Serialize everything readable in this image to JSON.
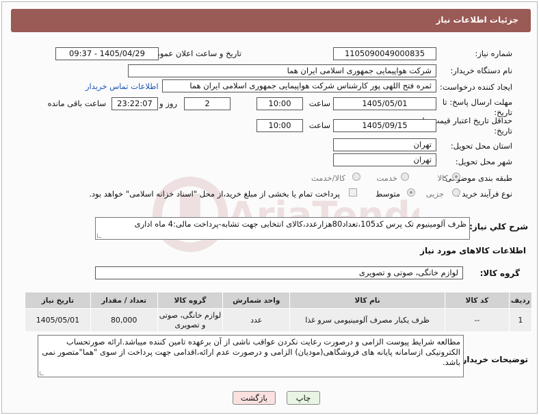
{
  "header": {
    "title": "جزئیات اطلاعات نیاز"
  },
  "fields": {
    "need_number_label": "شماره نیاز:",
    "need_number": "1105090049000835",
    "announce_label": "تاریخ و ساعت اعلان عمومی:",
    "announce_value": "1405/04/29 - 09:37",
    "buyer_org_label": "نام دستگاه خریدار:",
    "buyer_org": "شرکت هواپیمایی جمهوری اسلامی ایران هما",
    "requester_label": "ایجاد کننده درخواست:",
    "requester": "ثمره فتح اللهی پور کارشناس شرکت هواپیمایی جمهوری اسلامی ایران هما",
    "contact_link": "اطلاعات تماس خریدار",
    "reply_deadline_label": "مهلت ارسال پاسخ: تا تاریخ:",
    "reply_date": "1405/05/01",
    "time_label": "ساعت",
    "reply_time": "10:00",
    "days": "2",
    "days_label": "روز و",
    "remaining_time": "23:22:07",
    "remaining_label": "ساعت باقی مانده",
    "price_validity_label": "حداقل تاریخ اعتبار قیمت: تا تاریخ:",
    "price_date": "1405/09/15",
    "price_time": "10:00",
    "province_label": "استان محل تحویل:",
    "province": "تهران",
    "city_label": "شهر محل تحویل:",
    "city": "تهران",
    "category_label": "طبقه بندی موضوعی:",
    "category_options": [
      "کالا",
      "خدمت",
      "کالا/خدمت"
    ],
    "process_label": "نوع فرآیند خرید :",
    "process_options": [
      "جزیی",
      "متوسط"
    ],
    "payment_note": "پرداخت تمام یا بخشی از مبلغ خرید،از محل \"اسناد خزانه اسلامی\" خواهد بود."
  },
  "description": {
    "label": "شرح کلي نیاز:",
    "text": "ظرف آلومینیوم تک پرس کد105،تعداد80هزارعدد،کالای انتخابی جهت تشابه-پرداخت مالی:4 ماه اداری"
  },
  "goods_info": {
    "title": "اطلاعات کالاهای مورد نیاز",
    "group_label": "گروه کالا:",
    "group_value": "لوازم خانگی، صوتی و تصویری"
  },
  "table": {
    "headers": [
      "ردیف",
      "کد کالا",
      "نام کالا",
      "واحد شمارش",
      "گروه کالا",
      "تعداد / مقدار",
      "تاریخ نیاز"
    ],
    "rows": [
      [
        "1",
        "--",
        "ظرف یکبار مصرف آلومینیومی سرو غذا",
        "عدد",
        "لوازم خانگی، صوتی و تصویری",
        "80,000",
        "1405/05/01"
      ]
    ]
  },
  "buyer_notes": {
    "label": "توضیحات خریدار:",
    "text": "مطالعه شرایط پیوست الزامی و درصورت رعایت نکردن عواقب ناشی از آن برعهده تامین کننده میباشد.ارائه صورتحساب الکترونیکی ازسامانه پایانه های فروشگاهی(مودیان) الزامی و درصورت عدم ارائه،اقدامی جهت پرداخت از سوی \"هما\"متصور نمی باشد."
  },
  "buttons": {
    "print": "چاپ",
    "back": "بازگشت"
  },
  "colors": {
    "header": "#9a5a55",
    "link": "#1a56b8",
    "back_button": "#fbe0e0",
    "print_button": "#e8f5e4"
  },
  "watermark": {
    "text": "AriaTender.net"
  }
}
